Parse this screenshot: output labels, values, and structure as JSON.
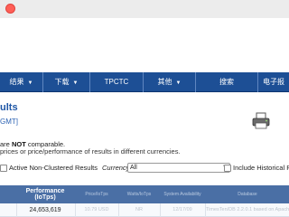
{
  "navbar": {
    "items": [
      {
        "label": "结果",
        "has_caret": true
      },
      {
        "label": "下载",
        "has_caret": true
      },
      {
        "label": "TPCTC",
        "has_caret": false
      },
      {
        "label": "其他",
        "has_caret": true
      },
      {
        "label": "搜索",
        "has_caret": false
      },
      {
        "label": "电子报",
        "has_caret": false
      }
    ],
    "caret_glyph": "▼"
  },
  "page": {
    "title": "ults",
    "timezone": "GMT]"
  },
  "notes": {
    "line1_before": "are ",
    "line1_bold": "NOT",
    "line1_after": " comparable.",
    "line2": "prices or price/performance of results in different currencies."
  },
  "filters": {
    "active_non_clustered": "Active Non-Clustered Results",
    "currency_label": "Currency:",
    "currency_value": "All",
    "include_historical": "Include Historical Res"
  },
  "table": {
    "headers": [
      "Performance (IoTps)",
      "Price/IoTps",
      "Watts/IoTps",
      "System Availability",
      "Database"
    ],
    "rows": [
      [
        "24,653,619",
        "10.79 USD",
        "NR",
        "12/17/09",
        "TimesTen/DB 2.2.0.1 based on Apache IoTDB"
      ]
    ]
  },
  "colors": {
    "navbar": "#1d4f95",
    "title": "#1e56a6",
    "table_header": "#4a6fa5"
  }
}
